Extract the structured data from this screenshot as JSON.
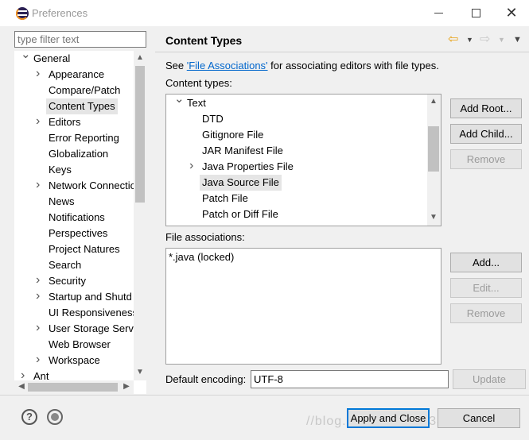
{
  "window": {
    "title": "Preferences",
    "minimize_label": "",
    "close_label": "✕"
  },
  "sidebar": {
    "filter_placeholder": "type filter text",
    "items": [
      {
        "label": "General",
        "level": 0,
        "expander": "down"
      },
      {
        "label": "Appearance",
        "level": 1,
        "expander": "right"
      },
      {
        "label": "Compare/Patch",
        "level": 1,
        "expander": ""
      },
      {
        "label": "Content Types",
        "level": 1,
        "expander": "",
        "selected": true
      },
      {
        "label": "Editors",
        "level": 1,
        "expander": "right"
      },
      {
        "label": "Error Reporting",
        "level": 1,
        "expander": ""
      },
      {
        "label": "Globalization",
        "level": 1,
        "expander": ""
      },
      {
        "label": "Keys",
        "level": 1,
        "expander": ""
      },
      {
        "label": "Network Connectio",
        "level": 1,
        "expander": "right"
      },
      {
        "label": "News",
        "level": 1,
        "expander": ""
      },
      {
        "label": "Notifications",
        "level": 1,
        "expander": ""
      },
      {
        "label": "Perspectives",
        "level": 1,
        "expander": ""
      },
      {
        "label": "Project Natures",
        "level": 1,
        "expander": ""
      },
      {
        "label": "Search",
        "level": 1,
        "expander": ""
      },
      {
        "label": "Security",
        "level": 1,
        "expander": "right"
      },
      {
        "label": "Startup and Shutd",
        "level": 1,
        "expander": "right"
      },
      {
        "label": "UI Responsiveness",
        "level": 1,
        "expander": ""
      },
      {
        "label": "User Storage Serv",
        "level": 1,
        "expander": "right"
      },
      {
        "label": "Web Browser",
        "level": 1,
        "expander": ""
      },
      {
        "label": "Workspace",
        "level": 1,
        "expander": "right"
      },
      {
        "label": "Ant",
        "level": 0,
        "expander": "right"
      }
    ]
  },
  "page": {
    "title": "Content Types",
    "see_prefix": "See ",
    "see_link": "'File Associations'",
    "see_suffix": " for associating editors with file types.",
    "content_types_label": "Content types:",
    "content_types": [
      {
        "label": "Text",
        "level": 0,
        "expander": "down"
      },
      {
        "label": "DTD",
        "level": 1,
        "expander": ""
      },
      {
        "label": "Gitignore File",
        "level": 1,
        "expander": ""
      },
      {
        "label": "JAR Manifest File",
        "level": 1,
        "expander": ""
      },
      {
        "label": "Java Properties File",
        "level": 1,
        "expander": "right"
      },
      {
        "label": "Java Source File",
        "level": 1,
        "expander": "",
        "selected": true
      },
      {
        "label": "Patch File",
        "level": 1,
        "expander": ""
      },
      {
        "label": "Patch or Diff File",
        "level": 1,
        "expander": ""
      }
    ],
    "add_root_label": "Add Root...",
    "add_child_label": "Add Child...",
    "remove_type_label": "Remove",
    "file_associations_label": "File associations:",
    "file_associations": [
      "*.java (locked)"
    ],
    "add_assoc_label": "Add...",
    "edit_assoc_label": "Edit...",
    "remove_assoc_label": "Remove",
    "default_encoding_label": "Default encoding:",
    "default_encoding_value": "UTF-8",
    "update_label": "Update"
  },
  "footer": {
    "help_symbol": "?",
    "apply_close_label": "Apply and Close",
    "cancel_label": "Cancel",
    "watermark": "//blog.csdn.net/qq_38409944"
  },
  "colors": {
    "link": "#0066cc",
    "default_button_border": "#0078d7",
    "nav_arrow": "#e8a317"
  }
}
